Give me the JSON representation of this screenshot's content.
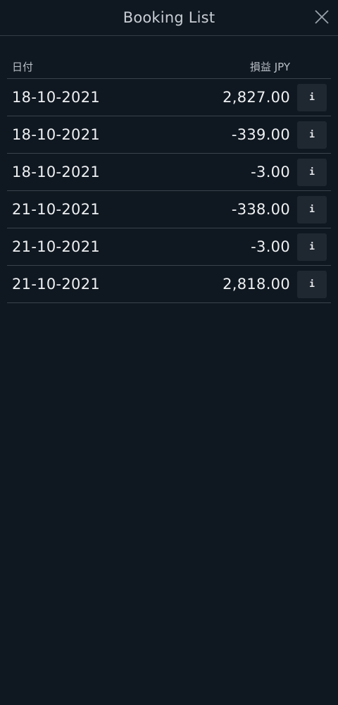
{
  "header": {
    "title": "Booking List",
    "close_icon": "close-icon"
  },
  "table": {
    "columns": {
      "date": "日付",
      "pnl": "損益 JPY"
    },
    "info_label": "i",
    "rows": [
      {
        "date": "18-10-2021",
        "amount": "2,827.00"
      },
      {
        "date": "18-10-2021",
        "amount": "-339.00"
      },
      {
        "date": "18-10-2021",
        "amount": "-3.00"
      },
      {
        "date": "21-10-2021",
        "amount": "-338.00"
      },
      {
        "date": "21-10-2021",
        "amount": "-3.00"
      },
      {
        "date": "21-10-2021",
        "amount": "2,818.00"
      }
    ]
  },
  "colors": {
    "background": "#0f1720",
    "divider": "#3a424c",
    "info_button_bg": "#1f2731",
    "text": "#eef0f2"
  }
}
